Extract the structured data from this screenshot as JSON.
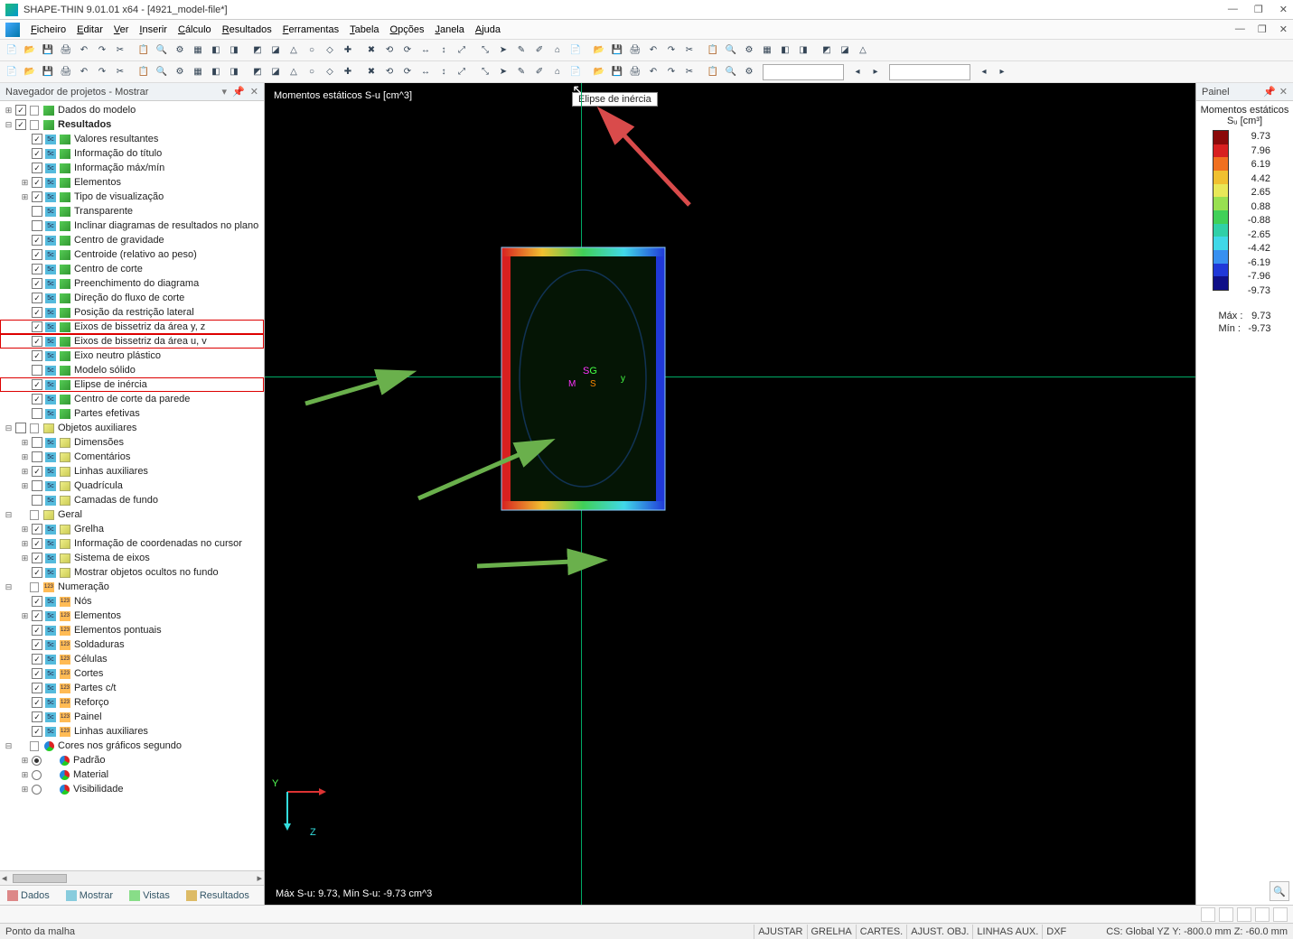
{
  "titlebar": {
    "title": "SHAPE-THIN 9.01.01 x64 - [4921_model-file*]"
  },
  "menu": [
    "Ficheiro",
    "Editar",
    "Ver",
    "Inserir",
    "Cálculo",
    "Resultados",
    "Ferramentas",
    "Tabela",
    "Opções",
    "Janela",
    "Ajuda"
  ],
  "nav": {
    "header": "Navegador de projetos - Mostrar",
    "tabs": [
      "Dados",
      "Mostrar",
      "Vistas",
      "Resultados"
    ]
  },
  "tree": [
    {
      "d": 0,
      "exp": "+",
      "chk": true,
      "i1": "doc",
      "i2": "green",
      "lbl": "Dados do modelo"
    },
    {
      "d": 0,
      "exp": "-",
      "chk": true,
      "i1": "doc",
      "i2": "green",
      "lbl": "Resultados",
      "bold": true
    },
    {
      "d": 1,
      "exp": "",
      "chk": true,
      "i1": "5c",
      "i2": "green",
      "lbl": "Valores resultantes"
    },
    {
      "d": 1,
      "exp": "",
      "chk": true,
      "i1": "5c",
      "i2": "green",
      "lbl": "Informação do título"
    },
    {
      "d": 1,
      "exp": "",
      "chk": true,
      "i1": "5c",
      "i2": "green",
      "lbl": "Informação máx/mín"
    },
    {
      "d": 1,
      "exp": "+",
      "chk": true,
      "i1": "5c",
      "i2": "green",
      "lbl": "Elementos"
    },
    {
      "d": 1,
      "exp": "+",
      "chk": true,
      "i1": "5c",
      "i2": "green",
      "lbl": "Tipo de visualização"
    },
    {
      "d": 1,
      "exp": "",
      "chk": false,
      "i1": "5c",
      "i2": "green",
      "lbl": "Transparente"
    },
    {
      "d": 1,
      "exp": "",
      "chk": false,
      "i1": "5c",
      "i2": "green",
      "lbl": "Inclinar diagramas de resultados no plano"
    },
    {
      "d": 1,
      "exp": "",
      "chk": true,
      "i1": "5c",
      "i2": "green",
      "lbl": "Centro de gravidade"
    },
    {
      "d": 1,
      "exp": "",
      "chk": true,
      "i1": "5c",
      "i2": "green",
      "lbl": "Centroide (relativo ao peso)"
    },
    {
      "d": 1,
      "exp": "",
      "chk": true,
      "i1": "5c",
      "i2": "green",
      "lbl": "Centro de corte"
    },
    {
      "d": 1,
      "exp": "",
      "chk": true,
      "i1": "5c",
      "i2": "green",
      "lbl": "Preenchimento do diagrama"
    },
    {
      "d": 1,
      "exp": "",
      "chk": true,
      "i1": "5c",
      "i2": "green",
      "lbl": "Direção do fluxo de corte"
    },
    {
      "d": 1,
      "exp": "",
      "chk": true,
      "i1": "5c",
      "i2": "green",
      "lbl": "Posição da restrição lateral"
    },
    {
      "d": 1,
      "exp": "",
      "chk": true,
      "i1": "5c",
      "i2": "green",
      "lbl": "Eixos de bissetriz da área y, z",
      "hl": true
    },
    {
      "d": 1,
      "exp": "",
      "chk": true,
      "i1": "5c",
      "i2": "green",
      "lbl": "Eixos de bissetriz da área u, v",
      "hl": true
    },
    {
      "d": 1,
      "exp": "",
      "chk": true,
      "i1": "5c",
      "i2": "green",
      "lbl": "Eixo neutro plástico"
    },
    {
      "d": 1,
      "exp": "",
      "chk": false,
      "i1": "5c",
      "i2": "green",
      "lbl": "Modelo sólido"
    },
    {
      "d": 1,
      "exp": "",
      "chk": true,
      "i1": "5c",
      "i2": "green",
      "lbl": "Elipse de inércia",
      "hl": true
    },
    {
      "d": 1,
      "exp": "",
      "chk": true,
      "i1": "5c",
      "i2": "green",
      "lbl": "Centro de corte da parede"
    },
    {
      "d": 1,
      "exp": "",
      "chk": false,
      "i1": "5c",
      "i2": "green",
      "lbl": "Partes efetivas"
    },
    {
      "d": 0,
      "exp": "-",
      "chk": false,
      "i1": "doc",
      "i2": "yellow",
      "lbl": "Objetos auxiliares"
    },
    {
      "d": 1,
      "exp": "+",
      "chk": false,
      "i1": "5c",
      "i2": "yellow",
      "lbl": "Dimensões"
    },
    {
      "d": 1,
      "exp": "+",
      "chk": false,
      "i1": "5c",
      "i2": "yellow",
      "lbl": "Comentários"
    },
    {
      "d": 1,
      "exp": "+",
      "chk": true,
      "i1": "5c",
      "i2": "yellow",
      "lbl": "Linhas auxiliares"
    },
    {
      "d": 1,
      "exp": "+",
      "chk": false,
      "i1": "5c",
      "i2": "yellow",
      "lbl": "Quadrícula"
    },
    {
      "d": 1,
      "exp": "",
      "chk": false,
      "i1": "5c",
      "i2": "yellow",
      "lbl": "Camadas de fundo"
    },
    {
      "d": 0,
      "exp": "-",
      "chk": "",
      "i1": "doc",
      "i2": "yellow",
      "lbl": "Geral"
    },
    {
      "d": 1,
      "exp": "+",
      "chk": true,
      "i1": "5c",
      "i2": "yellow",
      "lbl": "Grelha"
    },
    {
      "d": 1,
      "exp": "+",
      "chk": true,
      "i1": "5c",
      "i2": "yellow",
      "lbl": "Informação de coordenadas no cursor"
    },
    {
      "d": 1,
      "exp": "+",
      "chk": true,
      "i1": "5c",
      "i2": "yellow",
      "lbl": "Sistema de eixos"
    },
    {
      "d": 1,
      "exp": "",
      "chk": true,
      "i1": "5c",
      "i2": "yellow",
      "lbl": "Mostrar objetos ocultos no fundo"
    },
    {
      "d": 0,
      "exp": "-",
      "chk": "",
      "i1": "doc",
      "i2": "123",
      "lbl": "Numeração"
    },
    {
      "d": 1,
      "exp": "",
      "chk": true,
      "i1": "5c",
      "i2": "123",
      "lbl": "Nós"
    },
    {
      "d": 1,
      "exp": "+",
      "chk": true,
      "i1": "5c",
      "i2": "123",
      "lbl": "Elementos"
    },
    {
      "d": 1,
      "exp": "",
      "chk": true,
      "i1": "5c",
      "i2": "123",
      "lbl": "Elementos pontuais"
    },
    {
      "d": 1,
      "exp": "",
      "chk": true,
      "i1": "5c",
      "i2": "123",
      "lbl": "Soldaduras"
    },
    {
      "d": 1,
      "exp": "",
      "chk": true,
      "i1": "5c",
      "i2": "123",
      "lbl": "Células"
    },
    {
      "d": 1,
      "exp": "",
      "chk": true,
      "i1": "5c",
      "i2": "123",
      "lbl": "Cortes"
    },
    {
      "d": 1,
      "exp": "",
      "chk": true,
      "i1": "5c",
      "i2": "123",
      "lbl": "Partes c/t"
    },
    {
      "d": 1,
      "exp": "",
      "chk": true,
      "i1": "5c",
      "i2": "123",
      "lbl": "Reforço"
    },
    {
      "d": 1,
      "exp": "",
      "chk": true,
      "i1": "5c",
      "i2": "123",
      "lbl": "Painel"
    },
    {
      "d": 1,
      "exp": "",
      "chk": true,
      "i1": "5c",
      "i2": "123",
      "lbl": "Linhas auxiliares"
    },
    {
      "d": 0,
      "exp": "-",
      "chk": "",
      "i1": "doc",
      "i2": "pie",
      "lbl": "Cores nos gráficos segundo"
    },
    {
      "d": 1,
      "exp": "+",
      "chk": "radio-on",
      "i1": "",
      "i2": "pie",
      "lbl": "Padrão"
    },
    {
      "d": 1,
      "exp": "+",
      "chk": "radio",
      "i1": "",
      "i2": "pie",
      "lbl": "Material"
    },
    {
      "d": 1,
      "exp": "+",
      "chk": "radio",
      "i1": "",
      "i2": "pie",
      "lbl": "Visibilidade"
    }
  ],
  "viewport": {
    "topLabel": "Momentos estáticos S-u [cm^3]",
    "tooltip": "Elipse de inércia",
    "bottomLabel": "Máx S-u: 9.73, Mín S-u: -9.73 cm^3",
    "axis_y": "Y",
    "axis_z": "Z",
    "cg": {
      "s": "S",
      "g": "G",
      "m": "M",
      "y": "y"
    }
  },
  "panel": {
    "header": "Painel",
    "legendTitle1": "Momentos estáticos",
    "legendTitle2": "Sᵤ [cm³]",
    "colors": [
      "#8b0a0a",
      "#d82020",
      "#f07020",
      "#f0c030",
      "#e8e858",
      "#98e050",
      "#40d058",
      "#30d0a8",
      "#40d8e8",
      "#3890f0",
      "#2038d8",
      "#101088"
    ],
    "values": [
      "9.73",
      "7.96",
      "6.19",
      "4.42",
      "2.65",
      "0.88",
      "-0.88",
      "-2.65",
      "-4.42",
      "-6.19",
      "-7.96",
      "-9.73"
    ],
    "maxLabel": "Máx :",
    "maxVal": "9.73",
    "minLabel": "Mín :",
    "minVal": "-9.73"
  },
  "status": {
    "left": "Ponto da malha",
    "btns": [
      "AJUSTAR",
      "GRELHA",
      "CARTES.",
      "AJUST. OBJ.",
      "LINHAS AUX.",
      "DXF"
    ],
    "coords": "CS: Global YZ Y:   -800.0 mm   Z:   -60.0 mm"
  }
}
